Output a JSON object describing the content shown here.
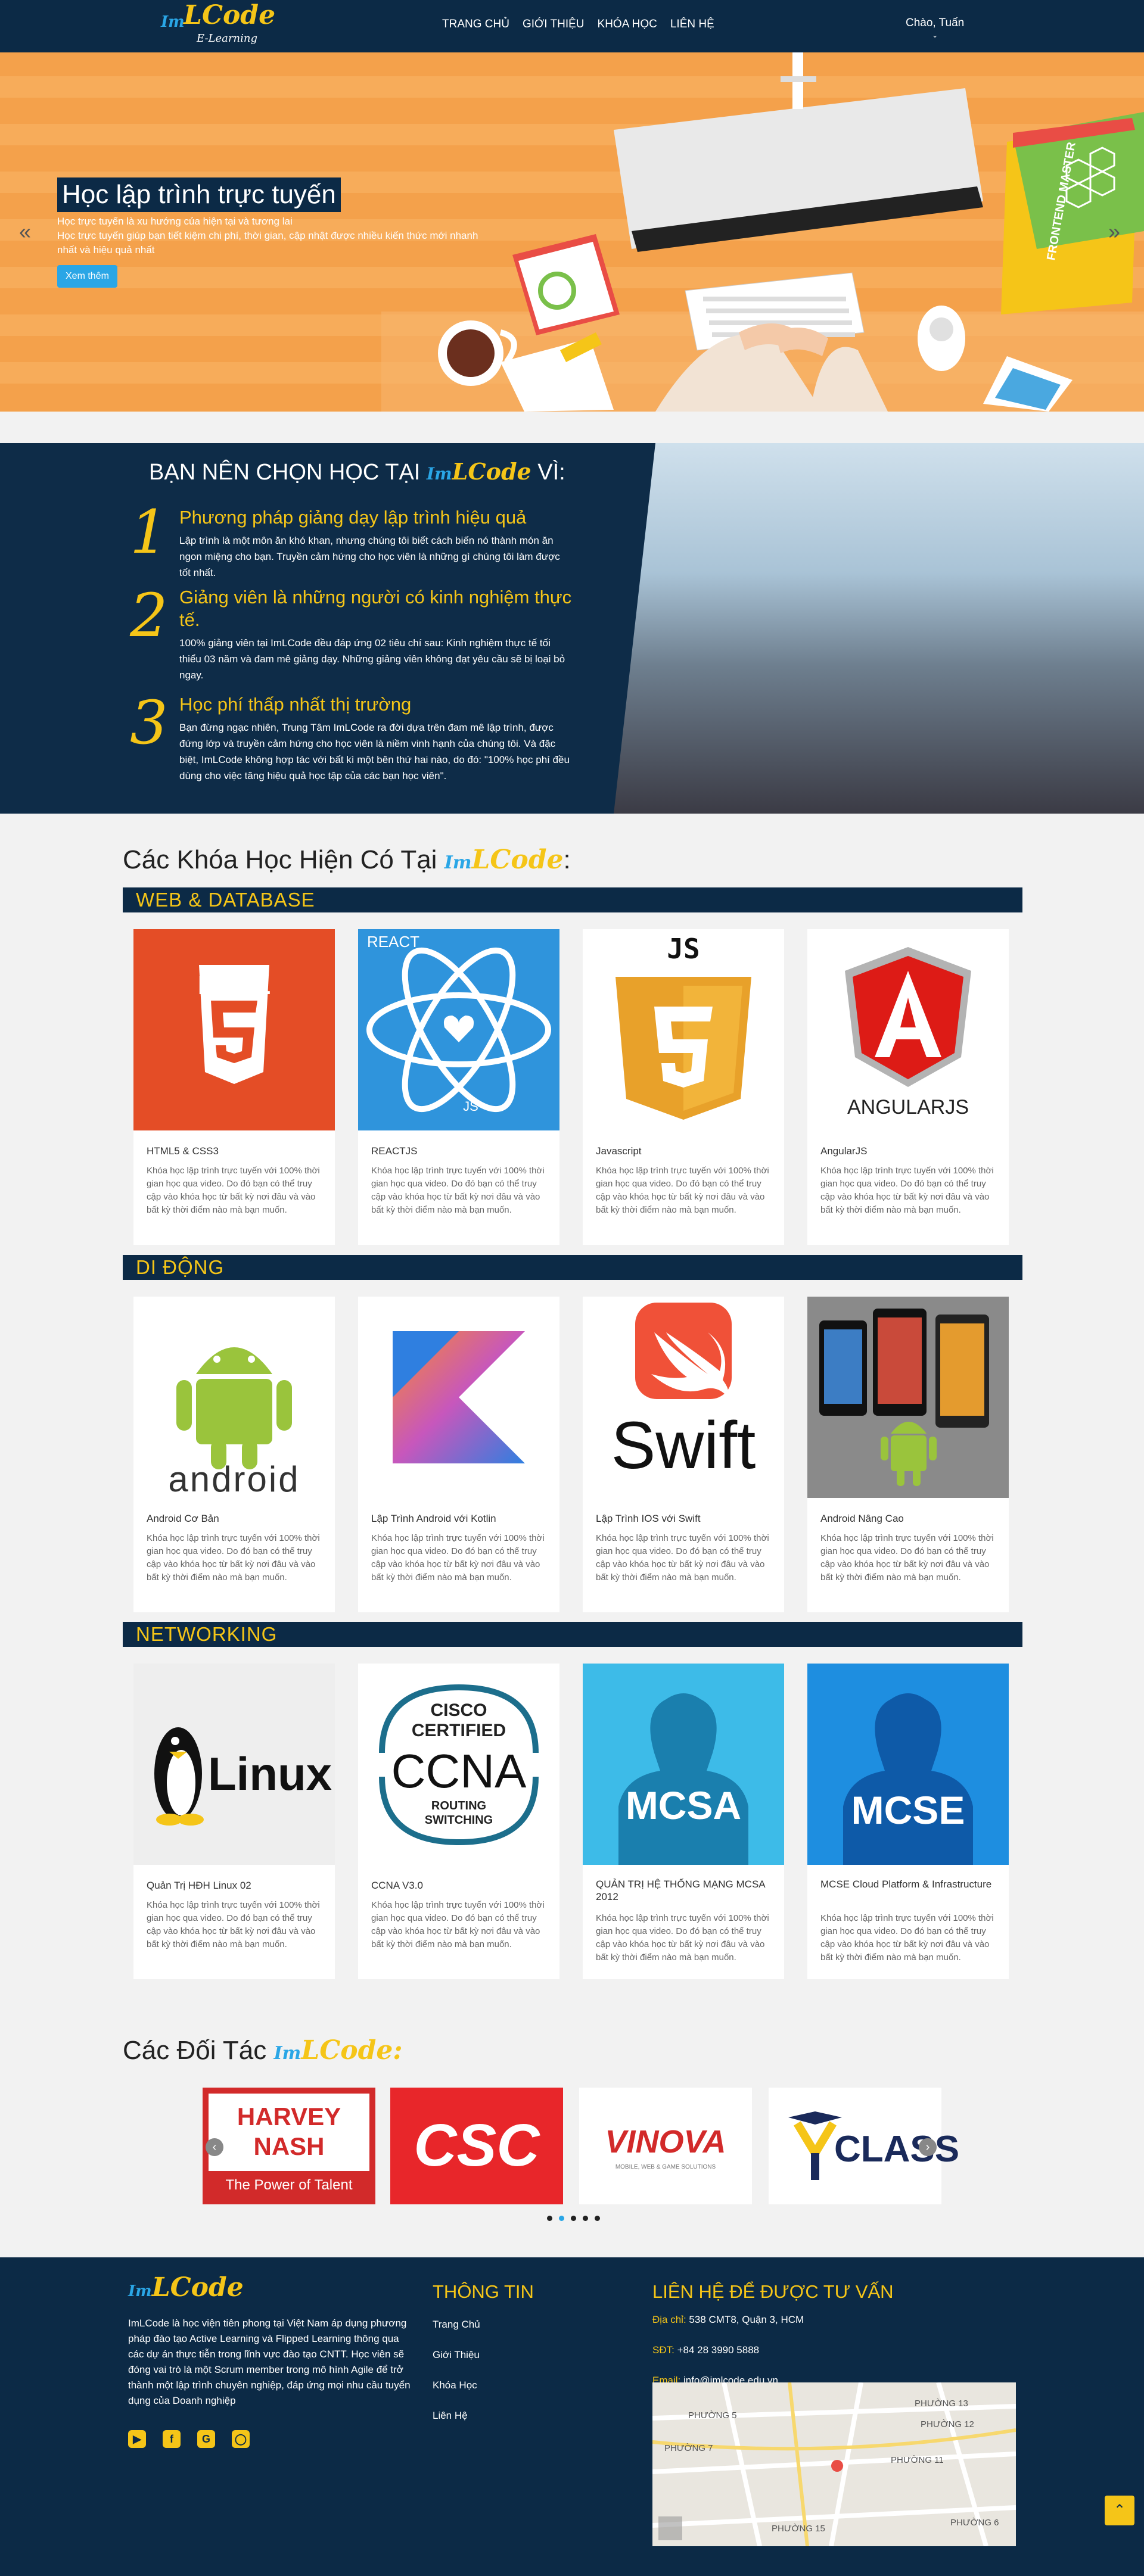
{
  "header": {
    "logo_im": "Im",
    "logo_lcode": "LCode",
    "logo_sub": "E-Learning",
    "nav": [
      "TRANG CHỦ",
      "GIỚI THIỆU",
      "KHÓA HỌC",
      "LIÊN HỆ"
    ],
    "user": "Chào, Tuấn"
  },
  "hero": {
    "title": "Học lập trình trực tuyến",
    "line1": "Học trực tuyến là xu hướng của hiện tại và tương lai",
    "line2": "Học trực tuyến giúp bạn tiết kiệm chi phí, thời gian, cập nhật được nhiều kiến thức mới nhanh nhất và hiệu quả nhất",
    "button": "Xem thêm",
    "book_text": "FRONTEND MASTER"
  },
  "why": {
    "title_pre": "BẠN NÊN CHỌN HỌC TẠI",
    "title_post": "VÌ:",
    "items": [
      {
        "num": "1",
        "head": "Phương pháp giảng dạy lập trình hiệu quả",
        "body": "Lập trình là một môn ăn khó khan, nhưng chúng tôi biết cách biến nó thành món ăn ngon miệng cho bạn. Truyền cảm hứng cho học viên là những gì chúng tôi làm được tốt nhất."
      },
      {
        "num": "2",
        "head": "Giảng viên là những người có kinh nghiệm thực tế.",
        "body": "100% giảng viên tại ImLCode đều đáp ứng 02 tiêu chí sau: Kinh nghiệm thực tế tối thiểu 03 năm và đam mê giảng dạy. Những giảng viên không đạt yêu cầu sẽ bị loại bỏ ngay."
      },
      {
        "num": "3",
        "head": "Học phí thấp nhất thị trường",
        "body": "Bạn đừng ngạc nhiên, Trung Tâm ImLCode ra đời dựa trên đam mê lập trình, được đứng lớp và truyền cảm hứng cho học viên là niềm vinh hạnh của chúng tôi. Và đặc biệt, ImLCode không hợp tác với bất kì một bên thứ hai nào, do đó: \"100% học phí đều dùng cho việc tăng hiệu quả học tập của các bạn học viên\"."
      }
    ]
  },
  "courses": {
    "title": "Các Khóa Học Hiện Có Tại",
    "title_colon": ":",
    "desc": "Khóa học lập trình trực tuyến với 100% thời gian học qua video. Do đó bạn có thể truy cập vào khóa học từ bất kỳ nơi đâu và vào bất kỳ thời điểm nào mà bạn muốn.",
    "categories": [
      {
        "name": "WEB & DATABASE",
        "items": [
          "HTML5 & CSS3",
          "REACTJS",
          "Javascript",
          "AngularJS"
        ]
      },
      {
        "name": "DI ĐỘNG",
        "items": [
          "Android Cơ Bản",
          "Lập Trình Android với Kotlin",
          "Lập Trình IOS với Swift",
          "Android Nâng Cao"
        ]
      },
      {
        "name": "NETWORKING",
        "items": [
          "Quản Trị HĐH Linux 02",
          "CCNA V3.0",
          "QUẢN TRỊ HỆ THỐNG MẠNG MCSA 2012",
          "MCSE Cloud Platform & Infrastructure"
        ]
      }
    ],
    "img_text": {
      "html": "HTML",
      "react": "REACT",
      "react_js": "JS",
      "js": "JS",
      "angular": "ANGULARJS",
      "android": "android",
      "swift": "Swift",
      "linux": "Linux",
      "cisco": "CISCO",
      "certified": "CERTIFIED",
      "ccna": "CCNA",
      "routing": "ROUTING",
      "switching": "SWITCHING",
      "mcsa": "MCSA",
      "mcse": "MCSE"
    }
  },
  "partners": {
    "title": "Các Đối Tác",
    "title_colon": ":",
    "logos": {
      "harvey": "HARVEY NASH",
      "harvey_sub": "The Power of Talent",
      "csc": "CSC",
      "vinova": "VINOVA",
      "vinova_sub": "MOBILE, WEB & GAME SOLUTIONS",
      "yclass": "CLASS"
    }
  },
  "footer": {
    "about": "ImLCode là học viện tiên phong tại Việt Nam áp dụng phương pháp đào tạo Active Learning và Flipped Learning thông qua các dự án thực tiễn trong lĩnh vực đào tạo CNTT. Học viên sẽ đóng vai trò là một Scrum member trong mô hình Agile để trở thành một lập trình chuyên nghiệp, đáp ứng mọi nhu cầu tuyển dụng của Doanh nghiệp",
    "info_title": "THÔNG TIN",
    "links": [
      "Trang Chủ",
      "Giới Thiệu",
      "Khóa Học",
      "Liên Hệ"
    ],
    "contact_title": "LIÊN HỆ ĐỂ ĐƯỢC TƯ VẤN",
    "address_label": "Địa chỉ:",
    "address": "538 CMT8, Quận 3, HCM",
    "phone_label": "SĐT:",
    "phone": "+84 28 3990 5888",
    "email_label": "Email:",
    "email": "info@imlcode.edu.vn",
    "social": [
      "youtube-icon",
      "facebook-icon",
      "google-plus-icon",
      "instagram-icon"
    ],
    "map_labels": [
      "PHƯỜNG 5",
      "PHƯỜNG 13",
      "PHƯỜNG 12",
      "PHƯỜNG 11",
      "PHƯỜNG 7",
      "PHƯỜNG 15",
      "PHƯỜNG 6"
    ]
  },
  "colors": {
    "navy": "#0c2a46",
    "accent": "#f5c518",
    "blue": "#2aa6e6",
    "hero_bg": "#f4a14b"
  }
}
